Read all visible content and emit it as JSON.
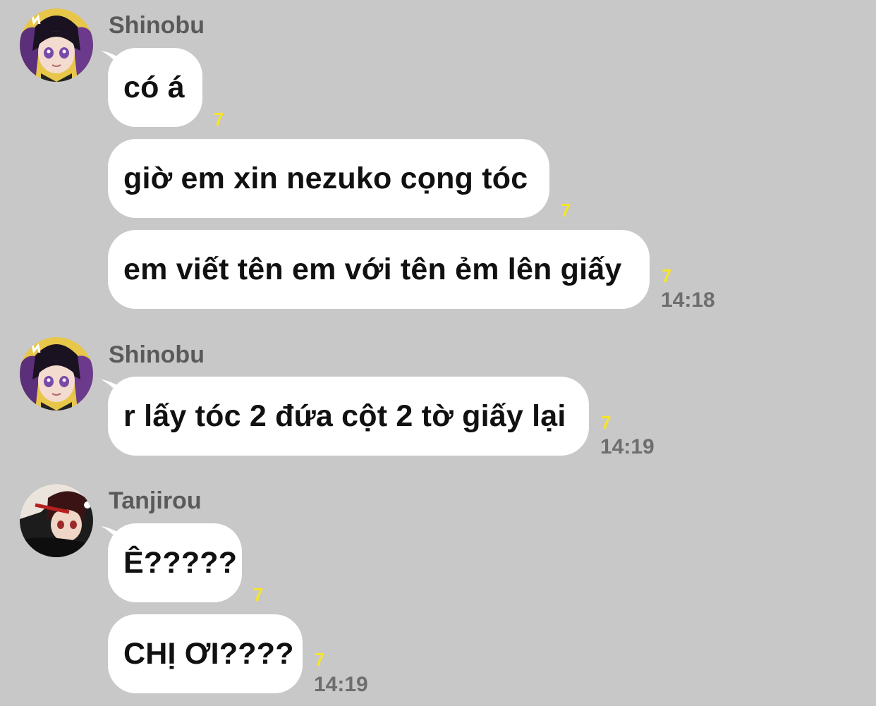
{
  "groups": [
    {
      "sender": "Shinobu",
      "avatar": "shinobu-avatar",
      "messages": [
        {
          "text": "có á",
          "read": "7",
          "time": ""
        },
        {
          "text": "giờ em xin nezuko cọng tóc",
          "read": "7",
          "time": ""
        },
        {
          "text": "em viết tên em với tên ẻm lên giấy",
          "read": "7",
          "time": "14:18"
        }
      ]
    },
    {
      "sender": "Shinobu",
      "avatar": "shinobu-avatar",
      "messages": [
        {
          "text": "r lấy tóc 2 đứa cột 2 tờ giấy lại",
          "read": "7",
          "time": "14:19"
        }
      ]
    },
    {
      "sender": "Tanjirou",
      "avatar": "tanjirou-avatar",
      "messages": [
        {
          "text": "Ê?????",
          "read": "7",
          "time": ""
        },
        {
          "text": "CHỊ ƠI????",
          "read": "7",
          "time": "14:19"
        }
      ]
    }
  ],
  "colors": {
    "background": "#c8c8c8",
    "bubble": "#ffffff",
    "read_count": "#f5e42a",
    "timestamp": "#6e6e6e",
    "sender": "#5a5a5a"
  }
}
